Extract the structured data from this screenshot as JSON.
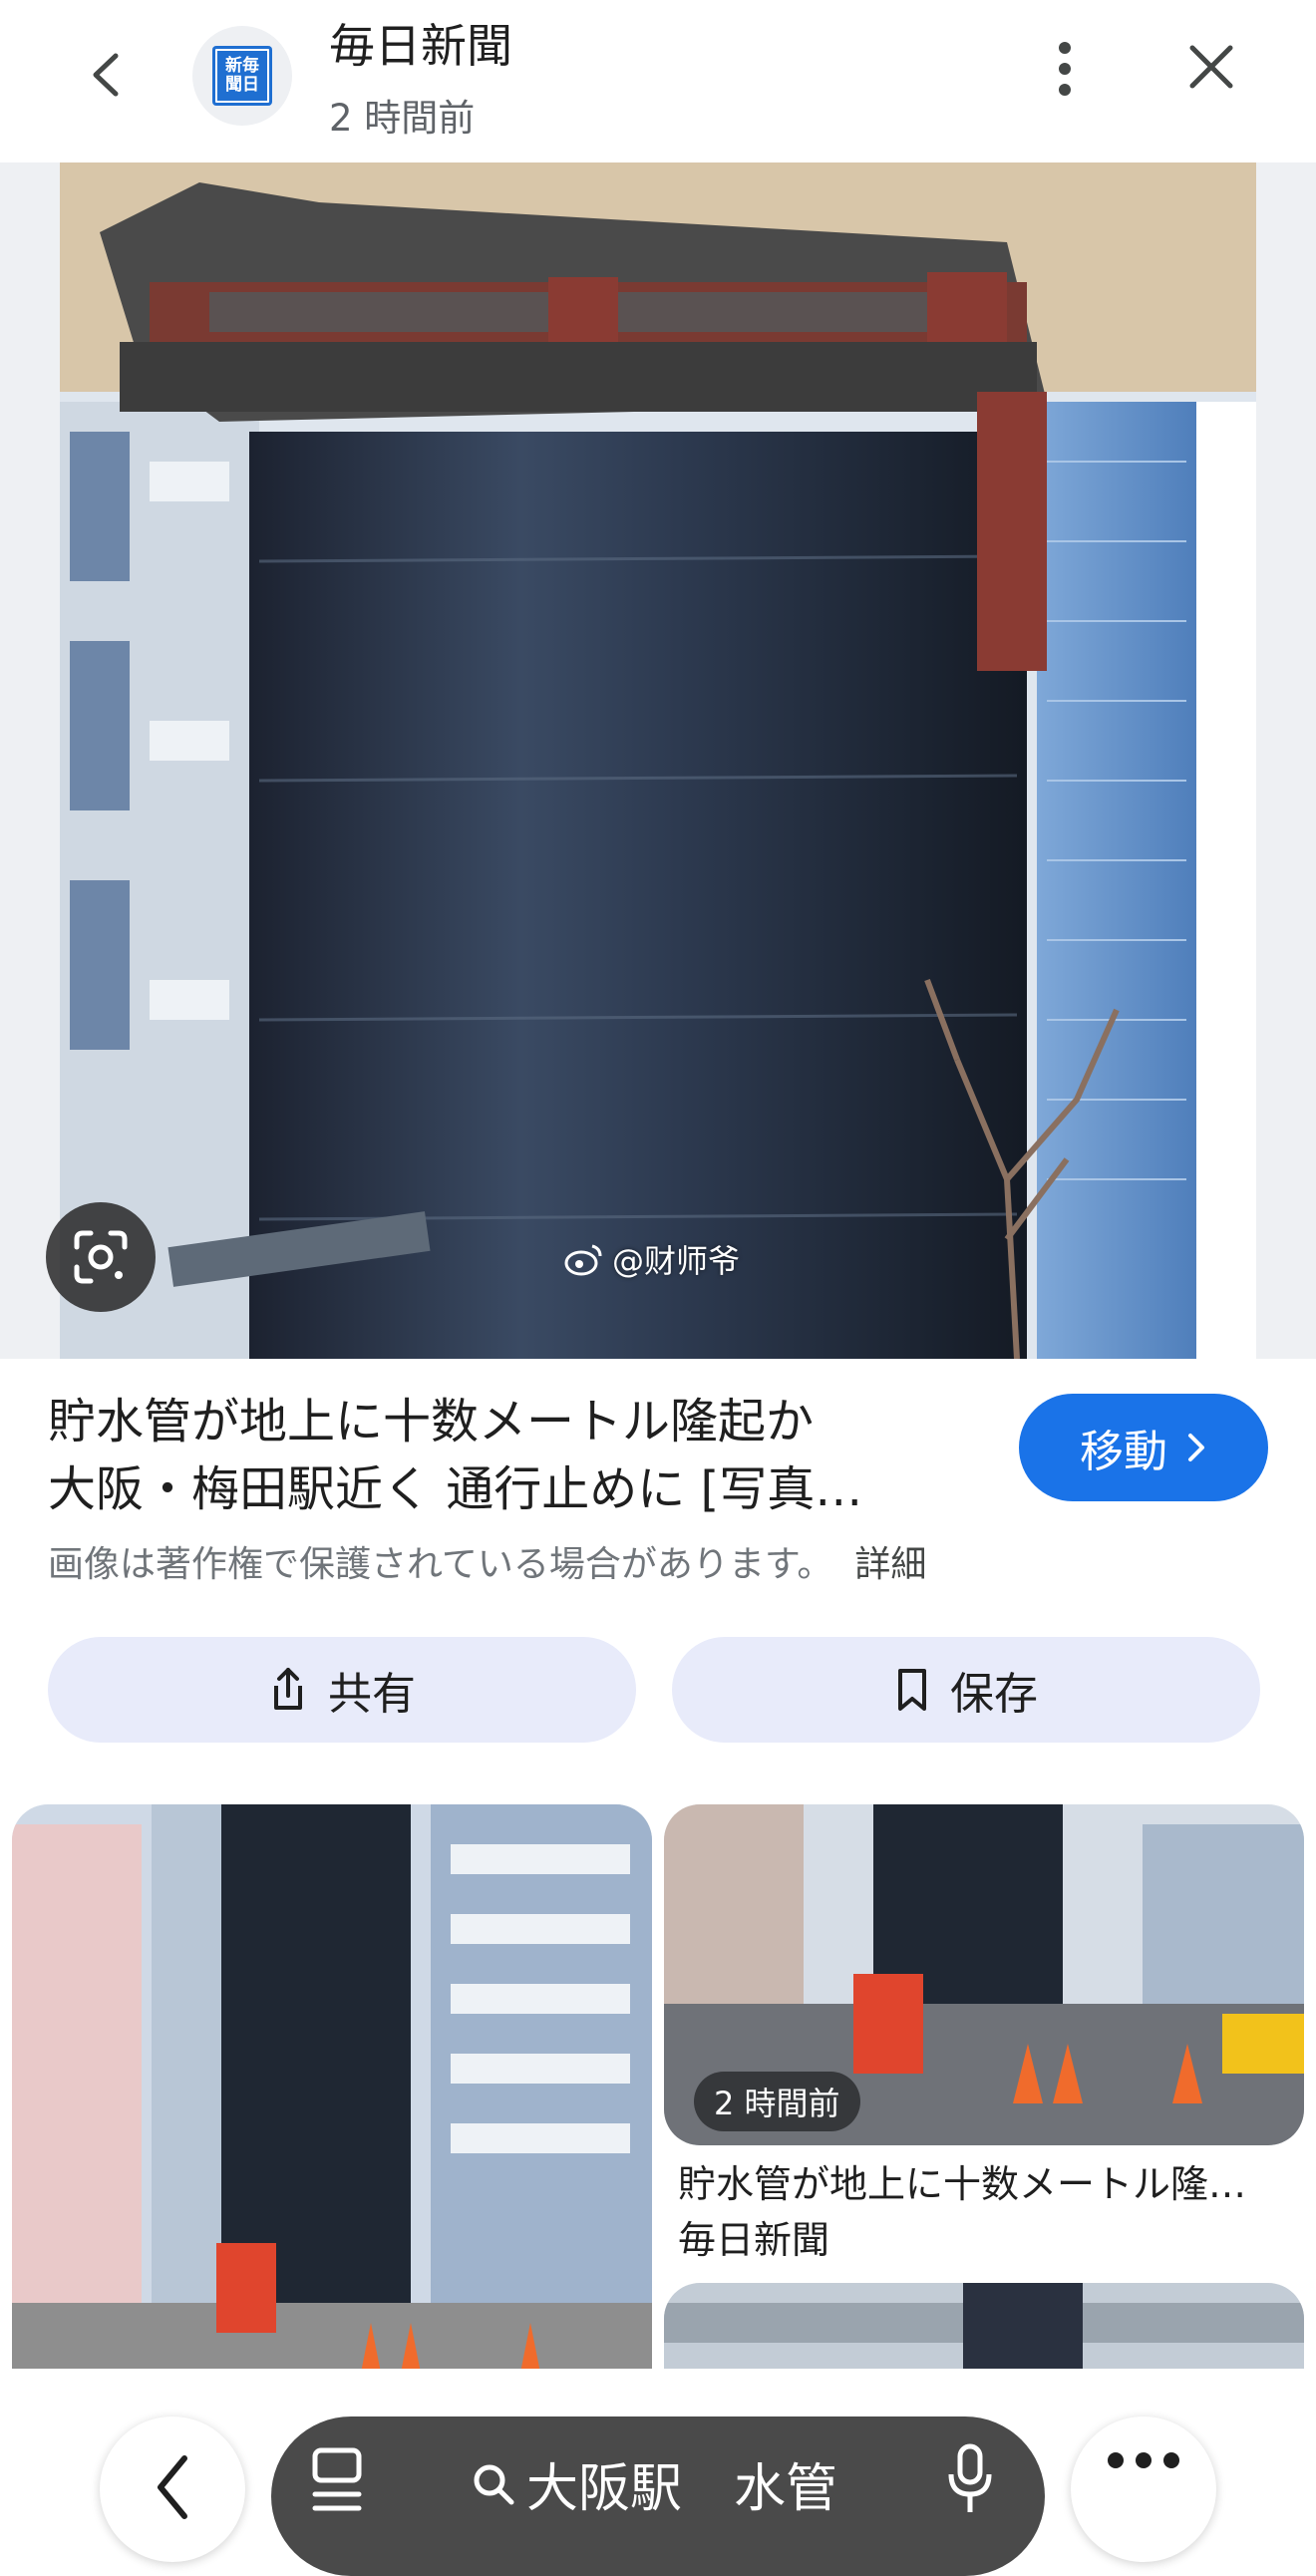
{
  "header": {
    "source_name": "毎日新聞",
    "logo_text": "新毎\n聞日",
    "time_ago": "2 時間前"
  },
  "hero": {
    "watermark": "@财师爷"
  },
  "article": {
    "title_line1": "貯水管が地上に十数メートル隆起か",
    "title_line2": "大阪・梅田駅近く 通行止めに [写真…",
    "visit_label": "移動",
    "copyright_notice": "画像は著作権で保護されている場合があります。",
    "details_label": "詳細"
  },
  "actions": {
    "share_label": "共有",
    "save_label": "保存"
  },
  "related": {
    "right_time_badge": "2 時間前",
    "right_title": "貯水管が地上に十数メートル隆…",
    "right_source": "毎日新聞"
  },
  "search_bar": {
    "query": "大阪駅　水管"
  },
  "colors": {
    "accent": "#1a73e8",
    "action_bg": "#e8ebfa",
    "search_pill": "#4a4a4a"
  }
}
